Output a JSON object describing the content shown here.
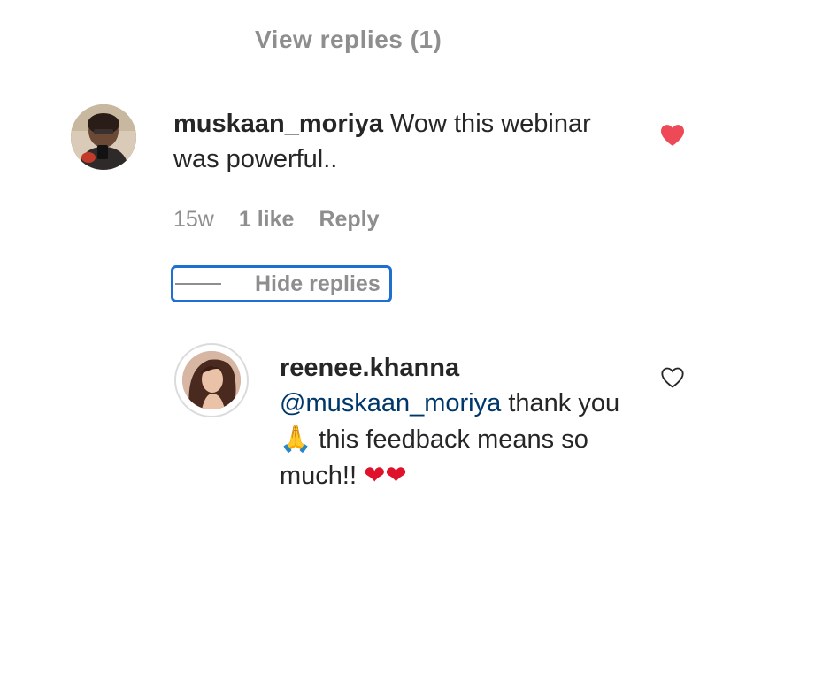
{
  "top_cutoff": {
    "label": "View replies (1)"
  },
  "comment": {
    "username": "muskaan_moriya",
    "text": " Wow this webinar was powerful..",
    "time": "15w",
    "likes": "1 like",
    "reply_label": "Reply",
    "liked": true
  },
  "hide_replies_label": "Hide replies",
  "reply": {
    "username": "reenee.khanna",
    "mention": "@muskaan_moriya",
    "text_part1": " thank you ",
    "emoji_pray": "🙏",
    "text_part2": " this feedback means so much!! ",
    "emoji_hearts": "❤❤",
    "liked": false
  },
  "colors": {
    "like_red": "#ed4956",
    "focus_blue": "#1f6fd1",
    "mention_blue": "#00376b",
    "muted_gray": "#8e8e8e"
  },
  "icons": {
    "comment_like": "heart-filled-icon",
    "reply_like": "heart-outline-icon"
  }
}
